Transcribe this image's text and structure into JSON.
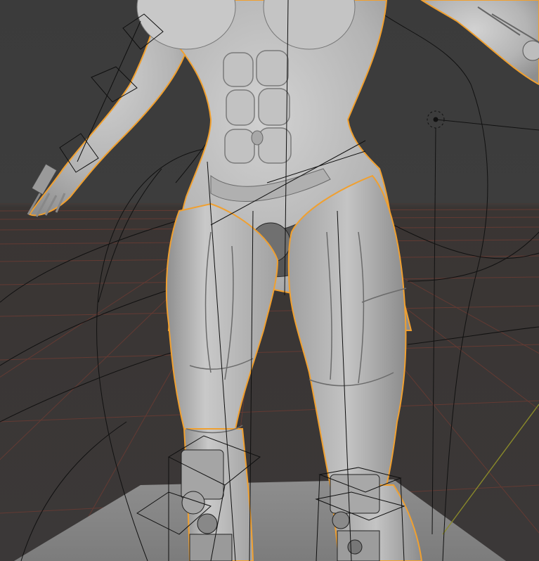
{
  "viewport": {
    "kind": "3D viewport",
    "shading": "solid",
    "background_color": "#3d3d3d",
    "floor_grid_color": "#5a3a33",
    "selection_outline_color": "#f0a030",
    "mesh_color": "#b8b8b8",
    "wireframe_color": "#111111",
    "y_axis_color": "#8a8a2a"
  },
  "objects": [
    {
      "name": "character-mesh",
      "selected": true
    },
    {
      "name": "armature-bones",
      "selected": false
    },
    {
      "name": "ground-plane",
      "selected": false
    },
    {
      "name": "light-empty",
      "selected": false
    }
  ]
}
